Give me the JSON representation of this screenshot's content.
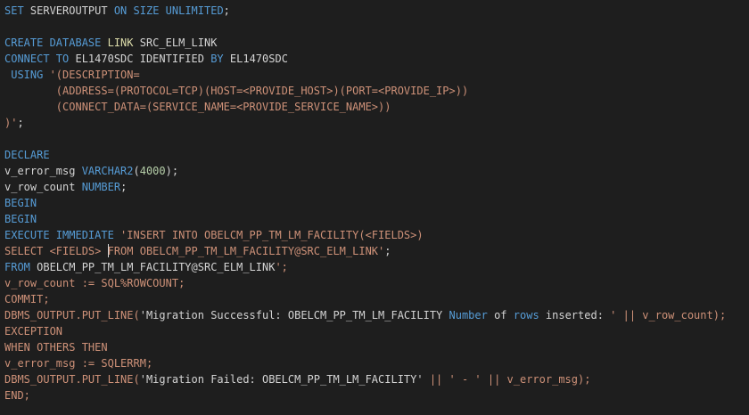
{
  "colors": {
    "background": "#1e1e1e",
    "default": "#d4d4d4",
    "keyword": "#569cd6",
    "string": "#ce9178",
    "number": "#b5cea8",
    "function": "#dcdcaa",
    "type": "#4ec9b0"
  },
  "editor": {
    "lines": [
      [
        {
          "t": "SET ",
          "c": "keyword"
        },
        {
          "t": "SERVEROUTPUT ",
          "c": "default"
        },
        {
          "t": "ON ",
          "c": "keyword"
        },
        {
          "t": "SIZE ",
          "c": "keyword"
        },
        {
          "t": "UNLIMITED",
          "c": "keyword"
        },
        {
          "t": ";",
          "c": "default"
        }
      ],
      [],
      [
        {
          "t": "CREATE ",
          "c": "keyword"
        },
        {
          "t": "DATABASE ",
          "c": "keyword"
        },
        {
          "t": "LINK ",
          "c": "function"
        },
        {
          "t": "SRC_ELM_LINK",
          "c": "default"
        }
      ],
      [
        {
          "t": "CONNECT ",
          "c": "keyword"
        },
        {
          "t": "TO ",
          "c": "keyword"
        },
        {
          "t": "EL1470SDC IDENTIFIED ",
          "c": "default"
        },
        {
          "t": "BY ",
          "c": "keyword"
        },
        {
          "t": "EL1470SDC",
          "c": "default"
        }
      ],
      [
        {
          "t": " USING ",
          "c": "keyword"
        },
        {
          "t": "'(DESCRIPTION=",
          "c": "string"
        }
      ],
      [
        {
          "t": "        (ADDRESS=(PROTOCOL=TCP)(HOST=<PROVIDE_HOST>)(PORT=<PROVIDE_IP>))",
          "c": "string"
        }
      ],
      [
        {
          "t": "        (CONNECT_DATA=(SERVICE_NAME=<PROVIDE_SERVICE_NAME>))",
          "c": "string"
        }
      ],
      [
        {
          "t": ")'",
          "c": "string"
        },
        {
          "t": ";",
          "c": "default"
        }
      ],
      [],
      [
        {
          "t": "DECLARE",
          "c": "keyword"
        }
      ],
      [
        {
          "t": "v_error_msg ",
          "c": "default"
        },
        {
          "t": "VARCHAR2",
          "c": "keyword"
        },
        {
          "t": "(",
          "c": "default"
        },
        {
          "t": "4000",
          "c": "number"
        },
        {
          "t": ");",
          "c": "default"
        }
      ],
      [
        {
          "t": "v_row_count ",
          "c": "default"
        },
        {
          "t": "NUMBER",
          "c": "keyword"
        },
        {
          "t": ";",
          "c": "default"
        }
      ],
      [
        {
          "t": "BEGIN",
          "c": "keyword"
        }
      ],
      [
        {
          "t": "BEGIN",
          "c": "keyword"
        }
      ],
      [
        {
          "t": "EXECUTE ",
          "c": "keyword"
        },
        {
          "t": "IMMEDIATE ",
          "c": "keyword"
        },
        {
          "t": "'INSERT INTO OBELCM_PP_TM_LM_FACILITY(<FIELDS>)",
          "c": "string"
        }
      ],
      [
        {
          "t": "SELECT <FIELDS> ",
          "c": "string"
        },
        {
          "cursor": true
        },
        {
          "t": "FROM OBELCM_PP_TM_LM_FACILITY@SRC_ELM_LINK'",
          "c": "string"
        },
        {
          "t": ";",
          "c": "default"
        }
      ],
      [
        {
          "t": "FROM ",
          "c": "keyword"
        },
        {
          "t": "OBELCM_PP_TM_LM_FACILITY@SRC_ELM_LINK",
          "c": "default"
        },
        {
          "t": "';",
          "c": "string"
        }
      ],
      [
        {
          "t": "v_row_count := SQL%ROWCOUNT;",
          "c": "string"
        }
      ],
      [
        {
          "t": "COMMIT;",
          "c": "string"
        }
      ],
      [
        {
          "t": "DBMS_OUTPUT.PUT_LINE(",
          "c": "string"
        },
        {
          "t": "'Migration Successful: OBELCM_PP_TM_LM_FACILITY ",
          "c": "default"
        },
        {
          "t": "Number ",
          "c": "keyword"
        },
        {
          "t": "of ",
          "c": "default"
        },
        {
          "t": "rows ",
          "c": "keyword"
        },
        {
          "t": "inserted: ",
          "c": "default"
        },
        {
          "t": "' || v_row_count);",
          "c": "string"
        }
      ],
      [
        {
          "t": "EXCEPTION",
          "c": "string"
        }
      ],
      [
        {
          "t": "WHEN OTHERS THEN",
          "c": "string"
        }
      ],
      [
        {
          "t": "v_error_msg := SQLERRM;",
          "c": "string"
        }
      ],
      [
        {
          "t": "DBMS_OUTPUT.PUT_LINE(",
          "c": "string"
        },
        {
          "t": "'Migration Failed: OBELCM_PP_TM_LM_FACILITY' ",
          "c": "default"
        },
        {
          "t": "|| ' - ' || v_error_msg);",
          "c": "string"
        }
      ],
      [
        {
          "t": "END;",
          "c": "string"
        }
      ]
    ]
  }
}
